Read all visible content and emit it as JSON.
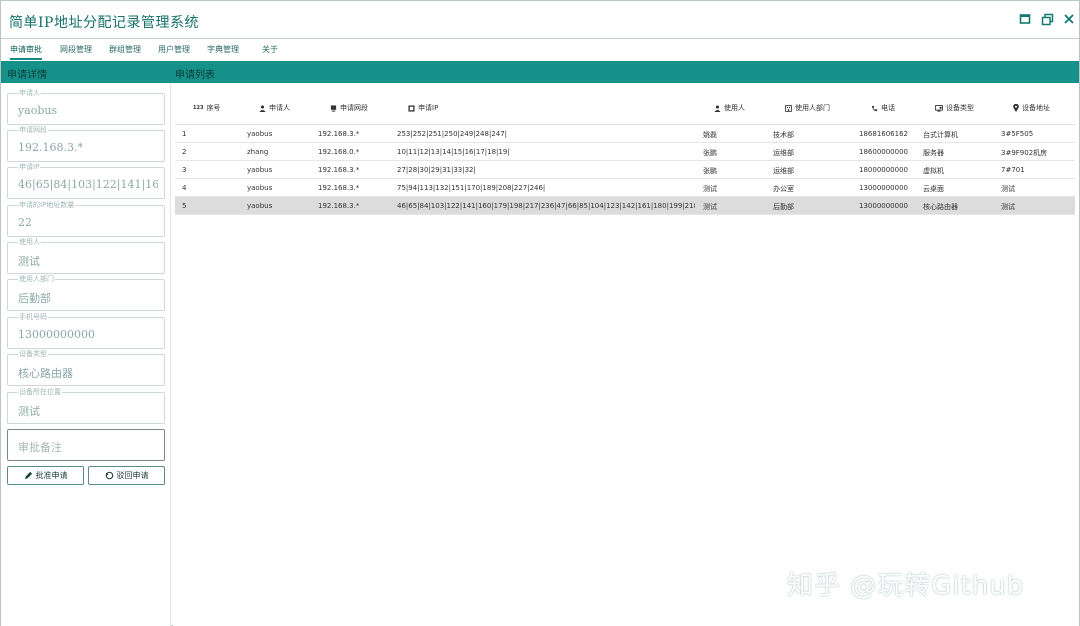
{
  "app": {
    "title": "简单IP地址分配记录管理系统"
  },
  "menu": [
    "申请审批",
    "网段管理",
    "群组管理",
    "用户管理",
    "字典管理",
    "关于"
  ],
  "left_section_title": "申请详情",
  "right_section_title": "申请列表",
  "form": {
    "fields": [
      {
        "label": "申请人",
        "value": "yaobus"
      },
      {
        "label": "申请网段",
        "value": "192.168.3.*"
      },
      {
        "label": "申请IP",
        "value": "46|65|84|103|122|141|160|"
      },
      {
        "label": "申请的IP地址数量",
        "value": "22"
      },
      {
        "label": "使用人",
        "value": "测试"
      },
      {
        "label": "使用人部门",
        "value": "后勤部"
      },
      {
        "label": "手机号码",
        "value": "13000000000"
      },
      {
        "label": "设备类型",
        "value": "核心路由器"
      },
      {
        "label": "设备所在位置",
        "value": "测试"
      }
    ],
    "remark_placeholder": "审批备注",
    "approve_label": "批准申请",
    "reject_label": "驳回申请"
  },
  "table": {
    "columns": [
      "序号",
      "申请人",
      "申请网段",
      "申请IP",
      "使用人",
      "使用人部门",
      "电话",
      "设备类型",
      "设备地址"
    ],
    "rows": [
      [
        "1",
        "yaobus",
        "192.168.3.*",
        "253|252|251|250|249|248|247|",
        "姚磊",
        "技术部",
        "18681606162",
        "台式计算机",
        "3#5F505"
      ],
      [
        "2",
        "zhang",
        "192.168.0.*",
        "10|11|12|13|14|15|16|17|18|19|",
        "张鹏",
        "运维部",
        "18600000000",
        "服务器",
        "3#9F902机房"
      ],
      [
        "3",
        "yaobus",
        "192.168.3.*",
        "27|28|30|29|31|33|32|",
        "张鹏",
        "运维部",
        "18000000000",
        "虚拟机",
        "7#701"
      ],
      [
        "4",
        "yaobus",
        "192.168.3.*",
        "75|94|113|132|151|170|189|208|227|246|",
        "测试",
        "办公室",
        "13000000000",
        "云桌面",
        "测试"
      ],
      [
        "5",
        "yaobus",
        "192.168.3.*",
        "46|65|84|103|122|141|160|179|198|217|236|47|66|85|104|123|142|161|180|199|218|237|",
        "测试",
        "后勤部",
        "13000000000",
        "核心路由器",
        "测试"
      ]
    ],
    "selected_row": 4,
    "header_icons": [
      "numbers-icon",
      "user-icon",
      "monitor-icon",
      "ip-icon",
      "user-icon",
      "building-icon",
      "phone-icon",
      "device-icon",
      "location-pin-icon"
    ],
    "number_icon_text": "123"
  },
  "watermark": "知乎 @玩转Github",
  "colors": {
    "accent": "#15918a",
    "title": "#15706a",
    "selected_row": "#dcdcdc"
  }
}
